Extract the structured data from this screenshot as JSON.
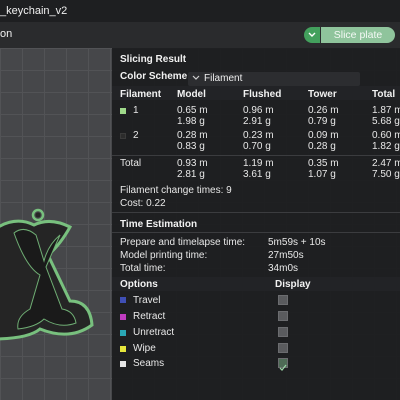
{
  "window": {
    "title": "_keychain_v2"
  },
  "toolbar": {
    "left_label": "on",
    "slice_label": "Slice plate"
  },
  "panel": {
    "title": "Slicing Result",
    "color_scheme_label": "Color Scheme",
    "color_scheme_value": "Filament",
    "columns": [
      "Filament",
      "Model",
      "Flushed",
      "Tower",
      "Total"
    ],
    "rows": [
      {
        "id": "1",
        "color": "#9fd98a",
        "model": [
          "0.65 m",
          "1.98 g"
        ],
        "flushed": [
          "0.96 m",
          "2.91 g"
        ],
        "tower": [
          "0.26 m",
          "0.79 g"
        ],
        "total": [
          "1.87 m",
          "5.68 g"
        ]
      },
      {
        "id": "2",
        "color": "#2c2c2c",
        "model": [
          "0.28 m",
          "0.83 g"
        ],
        "flushed": [
          "0.23 m",
          "0.70 g"
        ],
        "tower": [
          "0.09 m",
          "0.28 g"
        ],
        "total": [
          "0.60 m",
          "1.82 g"
        ]
      }
    ],
    "total_row": {
      "label": "Total",
      "model": [
        "0.93 m",
        "2.81 g"
      ],
      "flushed": [
        "1.19 m",
        "3.61 g"
      ],
      "tower": [
        "0.35 m",
        "1.07 g"
      ],
      "total": [
        "2.47 m",
        "7.50 g"
      ]
    },
    "filament_change": "Filament change times:  9",
    "cost": "Cost:  0.22",
    "time_title": "Time Estimation",
    "time_rows": [
      {
        "label": "Prepare and timelapse time:",
        "value": "5m59s + 10s"
      },
      {
        "label": "Model printing time:",
        "value": "27m50s"
      },
      {
        "label": "Total time:",
        "value": "34m0s"
      }
    ],
    "options_label": "Options",
    "display_label": "Display",
    "options": [
      {
        "label": "Travel",
        "color": "#3f4fb5",
        "checked": false
      },
      {
        "label": "Retract",
        "color": "#c03cc0",
        "checked": false
      },
      {
        "label": "Unretract",
        "color": "#2aa7b5",
        "checked": false
      },
      {
        "label": "Wipe",
        "color": "#e6e63c",
        "checked": false
      },
      {
        "label": "Seams",
        "color": "#e6e6e6",
        "checked": true
      }
    ]
  },
  "colors": {
    "accent": "#43a05d",
    "slice_button": "#8fc49c",
    "model_outline": "#78c07e",
    "model_fill": "#252525"
  }
}
